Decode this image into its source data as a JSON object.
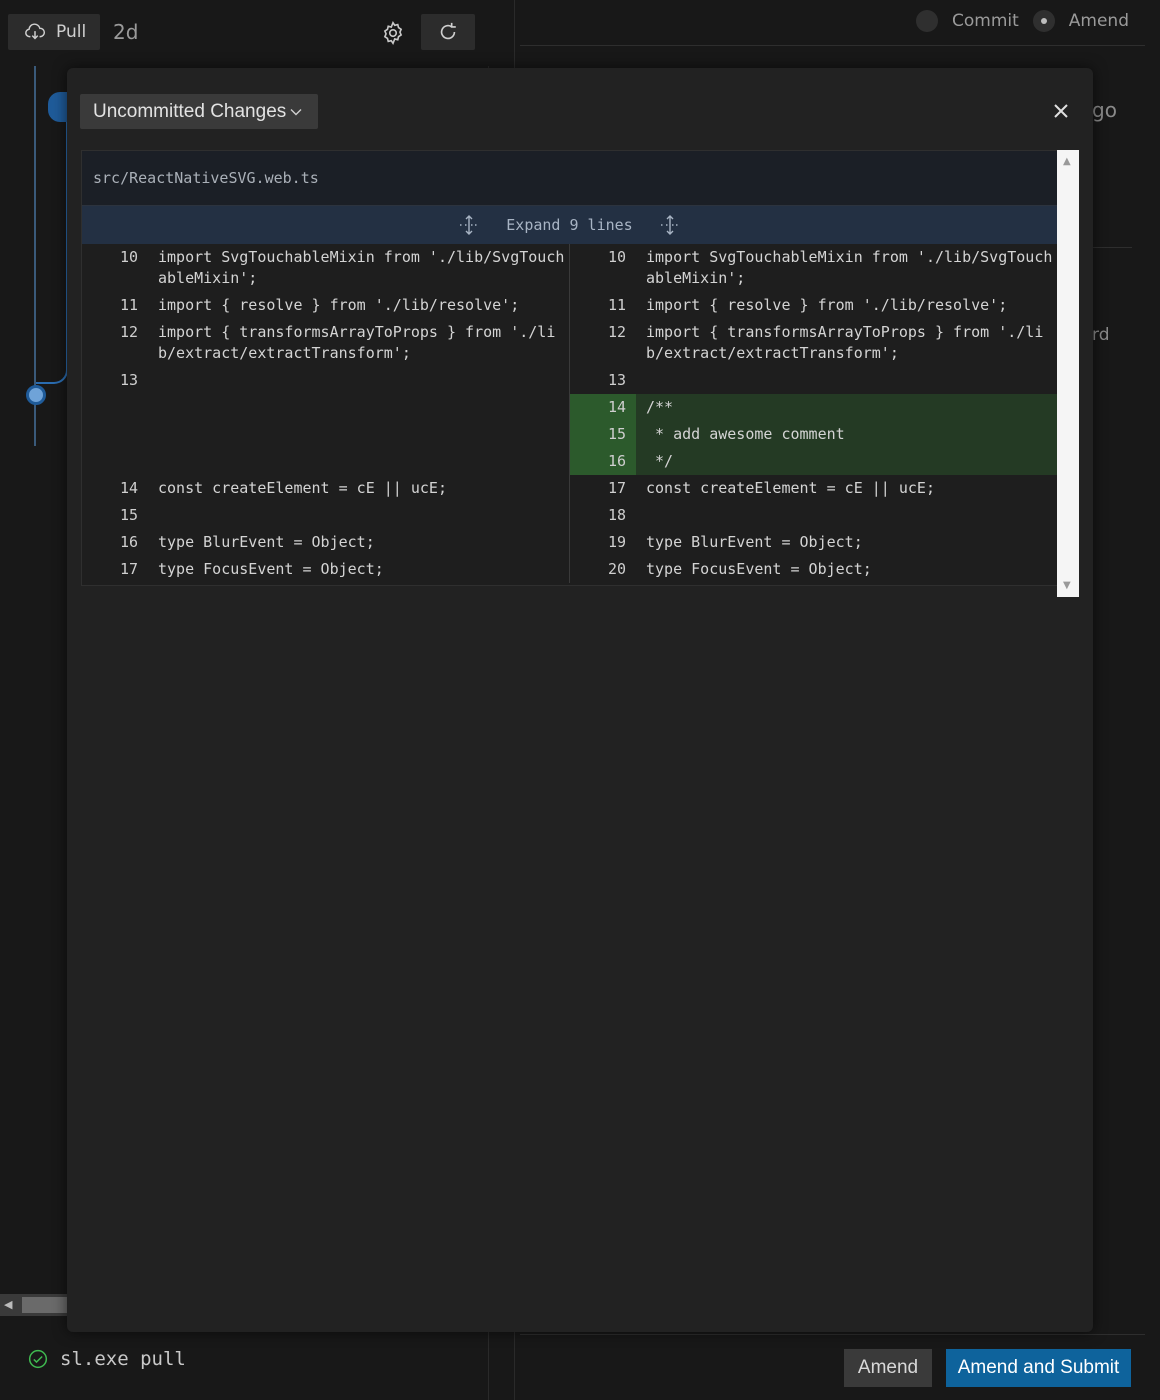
{
  "toolbar": {
    "pull_label": "Pull",
    "age": "2d",
    "commit_label": "Commit",
    "amend_label": "Amend",
    "ago_fragment": "go",
    "ard_fragment": "rd"
  },
  "modal": {
    "dropdown_label": "Uncommitted Changes",
    "file_path": "src/ReactNativeSVG.web.ts",
    "expand_label": "Expand 9 lines",
    "left_rows": [
      {
        "ln": "10",
        "code": "import SvgTouchableMixin from './lib/SvgTouchableMixin';",
        "type": "ctx"
      },
      {
        "ln": "11",
        "code": "import { resolve } from './lib/resolve';",
        "type": "ctx"
      },
      {
        "ln": "12",
        "code": "import { transformsArrayToProps } from './lib/extract/extractTransform';",
        "type": "ctx"
      },
      {
        "ln": "13",
        "code": "",
        "type": "ctx"
      },
      {
        "ln": "",
        "code": "",
        "type": "empty"
      },
      {
        "ln": "",
        "code": "",
        "type": "empty"
      },
      {
        "ln": "",
        "code": "",
        "type": "empty"
      },
      {
        "ln": "14",
        "code": "const createElement = cE || ucE;",
        "type": "ctx"
      },
      {
        "ln": "15",
        "code": "",
        "type": "ctx"
      },
      {
        "ln": "16",
        "code": "type BlurEvent = Object;",
        "type": "ctx"
      },
      {
        "ln": "17",
        "code": "type FocusEvent = Object;",
        "type": "ctx"
      }
    ],
    "right_rows": [
      {
        "ln": "10",
        "code": "import SvgTouchableMixin from './lib/SvgTouchableMixin';",
        "type": "ctx"
      },
      {
        "ln": "11",
        "code": "import { resolve } from './lib/resolve';",
        "type": "ctx"
      },
      {
        "ln": "12",
        "code": "import { transformsArrayToProps } from './lib/extract/extractTransform';",
        "type": "ctx"
      },
      {
        "ln": "13",
        "code": "",
        "type": "ctx"
      },
      {
        "ln": "14",
        "code": "/**",
        "type": "added"
      },
      {
        "ln": "15",
        "code": " * add awesome comment",
        "type": "added"
      },
      {
        "ln": "16",
        "code": " */",
        "type": "added"
      },
      {
        "ln": "17",
        "code": "const createElement = cE || ucE;",
        "type": "ctx"
      },
      {
        "ln": "18",
        "code": "",
        "type": "ctx"
      },
      {
        "ln": "19",
        "code": "type BlurEvent = Object;",
        "type": "ctx"
      },
      {
        "ln": "20",
        "code": "type FocusEvent = Object;",
        "type": "ctx"
      }
    ]
  },
  "status": {
    "command": "sl.exe pull"
  },
  "footer": {
    "amend_label": "Amend",
    "submit_label": "Amend and Submit"
  },
  "colors": {
    "accent": "#0e639c",
    "added_bg": "#243a24",
    "added_gutter": "#2c5a2c",
    "success": "#3fb950"
  },
  "icons": [
    "cloud-download-icon",
    "gear-icon",
    "refresh-icon",
    "chevron-down-icon",
    "close-icon",
    "expand-icon",
    "check-circle-icon"
  ]
}
